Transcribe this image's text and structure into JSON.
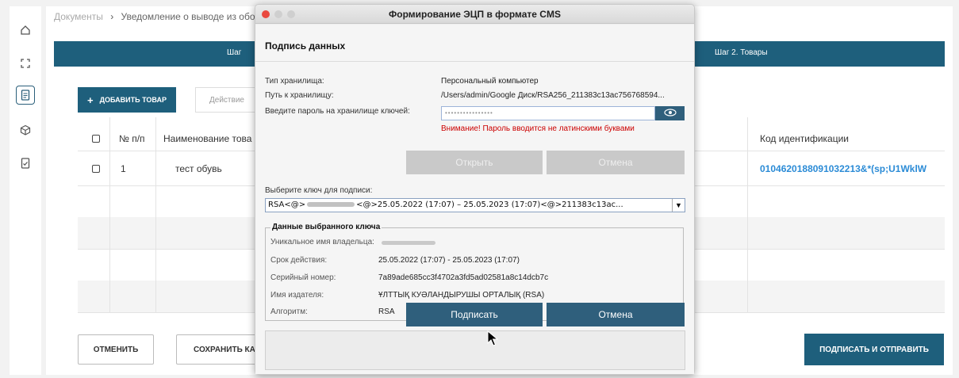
{
  "breadcrumb": {
    "root": "Документы",
    "sep": "›",
    "current": "Уведомление о выводе из оборота"
  },
  "steps": {
    "step1": "Шаг",
    "step2": "Шаг 2. Товары"
  },
  "toolbar": {
    "add_label": "ДОБАВИТЬ ТОВАР",
    "add_icon": "+",
    "action_placeholder": "Действие"
  },
  "table": {
    "headers": {
      "num": "№ п/п",
      "name": "Наименование това",
      "code": "Код идентификации"
    },
    "rows": [
      {
        "num": "1",
        "name": "тест обувь",
        "code": "0104620188091032213&*(sp;U1WklW"
      }
    ]
  },
  "footer": {
    "cancel": "ОТМЕНИТЬ",
    "save": "СОХРАНИТЬ КА",
    "submit": "ПОДПИСАТЬ И ОТПРАВИТЬ"
  },
  "dialog": {
    "title": "Формирование ЭЦП в формате CMS",
    "section": "Подпись данных",
    "storage_type_label": "Тип хранилища:",
    "storage_type_value": "Персональный компьютер",
    "storage_path_label": "Путь к хранилищу:",
    "storage_path_value": "/Users/admin/Google Диск/RSA256_211383c13ac756768594...",
    "password_label": "Введите пароль на хранилище ключей:",
    "password_value": "••••••••••••••••",
    "warning": "Внимание! Пароль вводится не латинскими буквами",
    "open_btn": "Открыть",
    "cancel_top_btn": "Отмена",
    "key_select_label": "Выберите ключ для подписи:",
    "key_prefix": "RSA<@>",
    "key_suffix": "<@>25.05.2022 (17:07) – 25.05.2023 (17:07)<@>211383c13ac...",
    "key_group_title": "Данные выбранного ключа",
    "owner_label": "Уникальное имя владельца:",
    "validity_label": "Срок действия:",
    "validity_value": "25.05.2022 (17:07) - 25.05.2023 (17:07)",
    "serial_label": "Серийный номер:",
    "serial_value": "7a89ade685cc3f4702a3fd5ad02581a8c14dcb7c",
    "issuer_label": "Имя издателя:",
    "issuer_value": "ҰЛТТЫҚ КУӘЛАНДЫРУШЫ ОРТАЛЫҚ (RSA)",
    "algo_label": "Алгоритм:",
    "algo_value": "RSA",
    "sign_btn": "Подписать",
    "cancel_btn": "Отмена"
  },
  "colors": {
    "primary": "#1e5f7c",
    "dialog_btn": "#2f5f7c",
    "warning": "#cc0000",
    "link": "#2b8bd6"
  }
}
